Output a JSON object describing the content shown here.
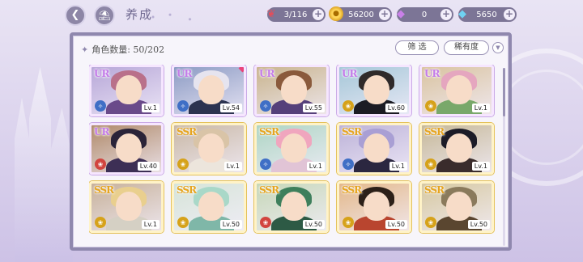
{
  "header": {
    "title": "养成",
    "back_icon": "back-arrow-icon",
    "home_icon": "home-icon"
  },
  "currencies": [
    {
      "name": "stamina",
      "icon": "candy-icon",
      "value": "3/116"
    },
    {
      "name": "gold",
      "icon": "coin-icon",
      "value": "56200"
    },
    {
      "name": "gem",
      "icon": "purple-diamond-icon",
      "value": "0"
    },
    {
      "name": "crystal",
      "icon": "blue-diamond-icon",
      "value": "5650"
    }
  ],
  "panel": {
    "count_label": "角色数量: 50/202",
    "filter_label": "筛 选",
    "sort_label": "稀有度"
  },
  "colors": {
    "ur": "#c47be9",
    "ssr": "#e6a521",
    "panel_border": "#8f88ae"
  },
  "cards": [
    {
      "rank": "UR",
      "level": "Lv.1",
      "attr": "blue",
      "hair": "#b9708a",
      "bg": "#b7a7d8",
      "outfit": "#6a4a8a"
    },
    {
      "rank": "UR",
      "level": "Lv.54",
      "attr": "blue",
      "hair": "#e6e4ef",
      "bg": "#8c9bc4",
      "outfit": "#2c3350",
      "new": true
    },
    {
      "rank": "UR",
      "level": "Lv.55",
      "attr": "blue",
      "hair": "#8a5a3c",
      "bg": "#c9b48e",
      "outfit": "#55407a"
    },
    {
      "rank": "UR",
      "level": "Lv.60",
      "attr": "yellow",
      "hair": "#2f2a2a",
      "bg": "#a5c7d8",
      "outfit": "#1c1c24"
    },
    {
      "rank": "UR",
      "level": "Lv.1",
      "attr": "yellow",
      "hair": "#e5a6bf",
      "bg": "#d9c3a0",
      "outfit": "#79a86a"
    },
    {
      "rank": "UR",
      "level": "Lv.40",
      "attr": "red",
      "hair": "#2a2338",
      "bg": "#b08a6a",
      "outfit": "#3d2f55"
    },
    {
      "rank": "SSR",
      "level": "Lv.1",
      "attr": "yellow",
      "hair": "#d9c4a7",
      "bg": "#c9b8a6",
      "outfit": "#ece5dc"
    },
    {
      "rank": "SSR",
      "level": "Lv.1",
      "attr": "blue",
      "hair": "#f0a6be",
      "bg": "#aed5c4",
      "outfit": "#e1c4d6"
    },
    {
      "rank": "SSR",
      "level": "Lv.1",
      "attr": "blue",
      "hair": "#a99fd4",
      "bg": "#bcb2d8",
      "outfit": "#2b2740"
    },
    {
      "rank": "SSR",
      "level": "Lv.1",
      "attr": "yellow",
      "hair": "#1c1c28",
      "bg": "#c6b898",
      "outfit": "#3a2c2c"
    },
    {
      "rank": "SSR",
      "level": "Lv.1",
      "attr": "yellow",
      "hair": "#e9cf8e",
      "bg": "#c7b19a",
      "outfit": "#d5d0c4"
    },
    {
      "rank": "SSR",
      "level": "Lv.50",
      "attr": "yellow",
      "hair": "#a9d8c8",
      "bg": "#d6e4d8",
      "outfit": "#7fb7a8"
    },
    {
      "rank": "SSR",
      "level": "Lv.50",
      "attr": "red",
      "hair": "#3e7f5c",
      "bg": "#c6d7b8",
      "outfit": "#2d5a45"
    },
    {
      "rank": "SSR",
      "level": "Lv.50",
      "attr": "yellow",
      "hair": "#2c2018",
      "bg": "#e3b88a",
      "outfit": "#b9452f"
    },
    {
      "rank": "SSR",
      "level": "Lv.50",
      "attr": "yellow",
      "hair": "#8a7a5c",
      "bg": "#d6c8a0",
      "outfit": "#5a4630"
    }
  ]
}
